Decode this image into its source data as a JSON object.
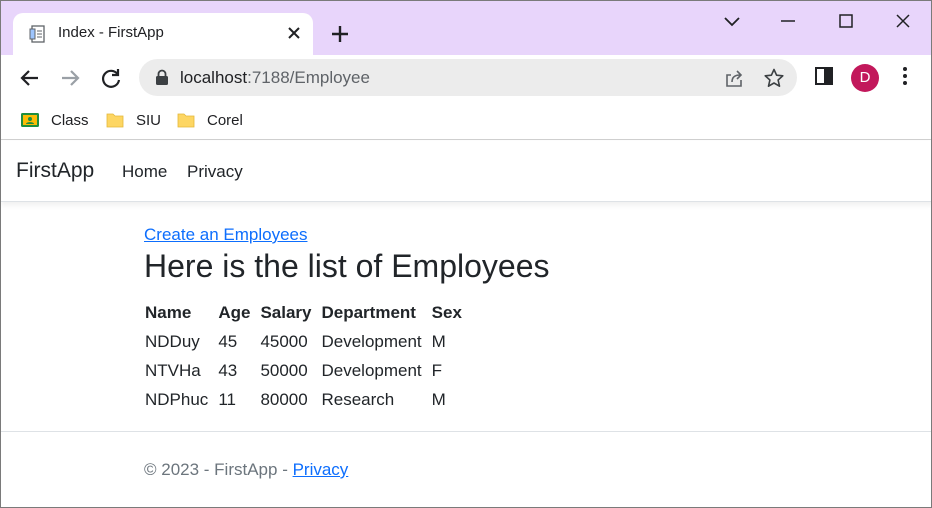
{
  "browser": {
    "tab_title": "Index - FirstApp",
    "url_host": "localhost",
    "url_path": ":7188/Employee",
    "profile_initial": "D",
    "accent_color": "#e8d5fb",
    "avatar_color": "#c2185b",
    "bookmarks": [
      {
        "label": "Class",
        "icon": "classroom-icon"
      },
      {
        "label": "SIU",
        "icon": "folder-icon"
      },
      {
        "label": "Corel",
        "icon": "folder-icon"
      }
    ]
  },
  "site": {
    "brand": "FirstApp",
    "nav": [
      "Home",
      "Privacy"
    ]
  },
  "main": {
    "create_link": "Create an Employees",
    "heading": "Here is the list of Employees",
    "columns": [
      "Name",
      "Age",
      "Salary",
      "Department",
      "Sex"
    ],
    "rows": [
      [
        "NDDuy",
        "45",
        "45000",
        "Development",
        "M"
      ],
      [
        "NTVHa",
        "43",
        "50000",
        "Development",
        "F"
      ],
      [
        "NDPhuc",
        "11",
        "80000",
        "Research",
        "M"
      ]
    ]
  },
  "footer": {
    "text": "© 2023 - FirstApp - ",
    "link": "Privacy"
  }
}
